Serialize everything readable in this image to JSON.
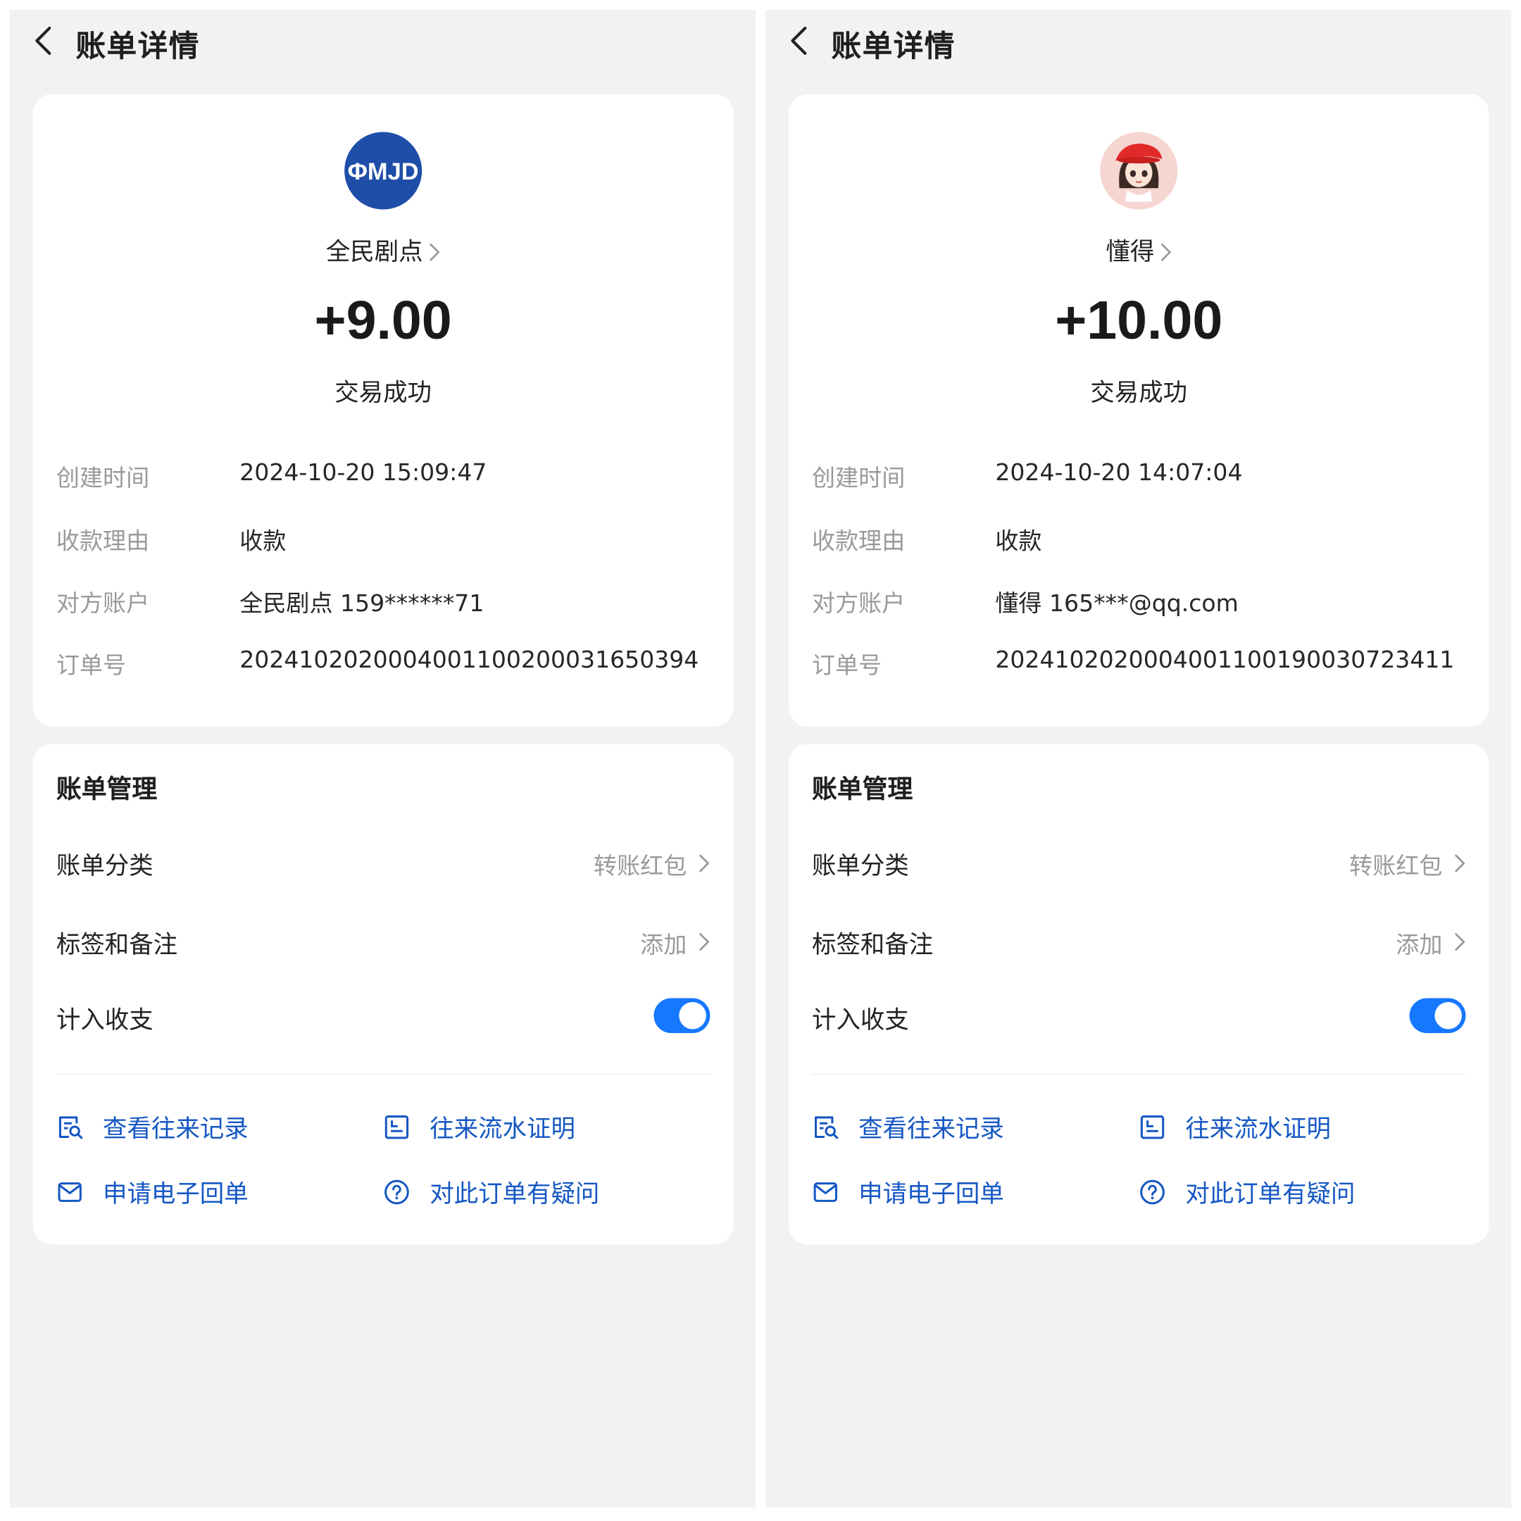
{
  "colors": {
    "accent": "#1677ff",
    "link_text": "#1557c4",
    "muted_text": "#9a9a9a",
    "page_background": "#f2f2f2",
    "card_background": "#ffffff"
  },
  "screens": [
    {
      "nav": {
        "title": "账单详情",
        "back_icon": "chevron-left-icon"
      },
      "payee": {
        "name": "全民剧点",
        "avatar_text": "ΦMJD",
        "avatar_color": "#1e4ea8"
      },
      "amount": "+9.00",
      "status": "交易成功",
      "details": [
        {
          "label": "创建时间",
          "value": "2024-10-20 15:09:47"
        },
        {
          "label": "收款理由",
          "value": "收款"
        },
        {
          "label": "对方账户",
          "value": "全民剧点 159******71"
        },
        {
          "label": "订单号",
          "value": "2024102020004001100200031650394"
        }
      ],
      "management": {
        "title": "账单管理",
        "rows": [
          {
            "label": "账单分类",
            "value": "转账红包"
          },
          {
            "label": "标签和备注",
            "value": "添加"
          },
          {
            "label": "计入收支",
            "toggle_on": true
          }
        ],
        "links": [
          {
            "label": "查看往来记录",
            "icon": "record-search-icon"
          },
          {
            "label": "往来流水证明",
            "icon": "statement-icon"
          },
          {
            "label": "申请电子回单",
            "icon": "mail-icon"
          },
          {
            "label": "对此订单有疑问",
            "icon": "help-circle-icon"
          }
        ]
      }
    },
    {
      "nav": {
        "title": "账单详情",
        "back_icon": "chevron-left-icon"
      },
      "payee": {
        "name": "懂得",
        "avatar_text": "",
        "avatar_color": "#f6d6d0"
      },
      "amount": "+10.00",
      "status": "交易成功",
      "details": [
        {
          "label": "创建时间",
          "value": "2024-10-20 14:07:04"
        },
        {
          "label": "收款理由",
          "value": "收款"
        },
        {
          "label": "对方账户",
          "value": "懂得 165***@qq.com"
        },
        {
          "label": "订单号",
          "value": "2024102020004001100190030723411"
        }
      ],
      "management": {
        "title": "账单管理",
        "rows": [
          {
            "label": "账单分类",
            "value": "转账红包"
          },
          {
            "label": "标签和备注",
            "value": "添加"
          },
          {
            "label": "计入收支",
            "toggle_on": true
          }
        ],
        "links": [
          {
            "label": "查看往来记录",
            "icon": "record-search-icon"
          },
          {
            "label": "往来流水证明",
            "icon": "statement-icon"
          },
          {
            "label": "申请电子回单",
            "icon": "mail-icon"
          },
          {
            "label": "对此订单有疑问",
            "icon": "help-circle-icon"
          }
        ]
      }
    }
  ]
}
